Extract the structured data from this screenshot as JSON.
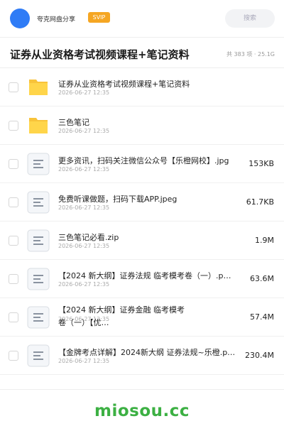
{
  "header": {
    "brand": "夸克网盘分享",
    "badge": "SVIP",
    "search_label": "搜索",
    "avatar_color": "#2f7cf6",
    "badge_color": "#f5a623"
  },
  "folder": {
    "title": "证券从业资格考试视频课程+笔记资料",
    "meta": "共 383 项 · 25.1G"
  },
  "files": [
    {
      "type": "folder",
      "icon": "folder-icon",
      "name": "证券从业资格考试视频课程+笔记资料",
      "date": "2026-06-27 12:35",
      "size": ""
    },
    {
      "type": "folder",
      "icon": "folder-icon",
      "name": "三色笔记",
      "date": "2026-06-27 12:35",
      "size": ""
    },
    {
      "type": "file",
      "icon": "document-icon",
      "name": "更多资讯，扫码关注微信公众号【乐橙网校】.jpg",
      "date": "2026-06-27 12:35",
      "size": "153KB"
    },
    {
      "type": "file",
      "icon": "document-icon",
      "name": "免费听课做题，扫码下载APP.jpeg",
      "date": "2026-06-27 12:35",
      "size": "61.7KB"
    },
    {
      "type": "file",
      "icon": "document-icon",
      "name": "三色笔记必看.zip",
      "date": "2026-06-27 12:35",
      "size": "1.9M"
    },
    {
      "type": "file",
      "icon": "document-icon",
      "name": "【2024 新大纲】证券法规 临考模考卷（一）.p…",
      "date": "2026-06-27 12:35",
      "size": "63.6M"
    },
    {
      "type": "file",
      "icon": "document-icon",
      "name": "【2024 新大纲】证券金融 临考模考卷（一）【优…",
      "date": "2026-06-27 12:35",
      "size": "57.4M"
    },
    {
      "type": "file",
      "icon": "document-icon",
      "name": "【金牌考点详解】2024新大纲 证券法规~乐橙.p…",
      "date": "2026-06-27 12:35",
      "size": "230.4M"
    }
  ],
  "footer": {
    "watermark": "miosou.cc",
    "watermark_color": "#3cb043"
  }
}
